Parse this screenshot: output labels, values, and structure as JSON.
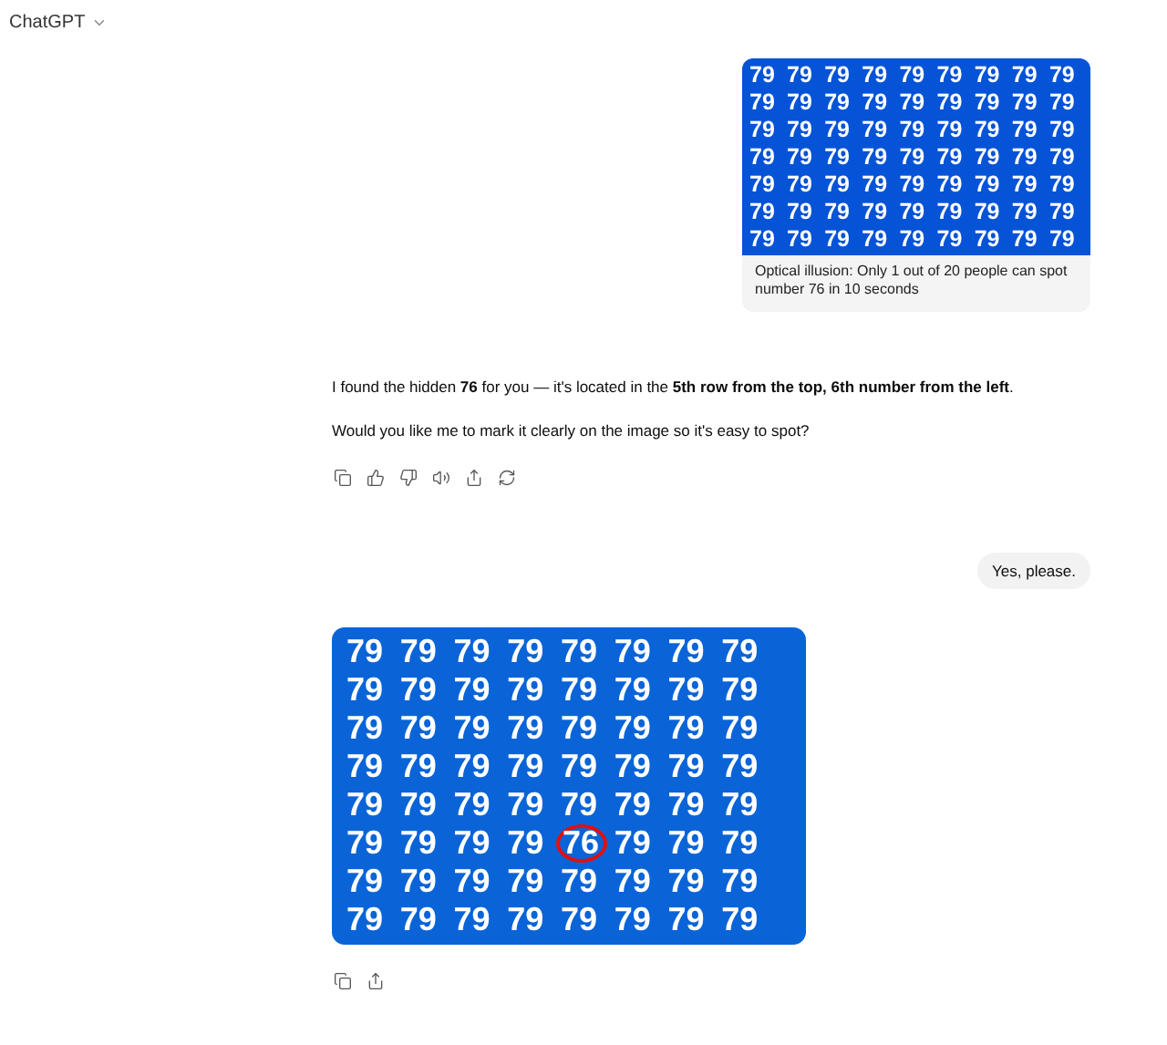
{
  "header": {
    "title": "ChatGPT"
  },
  "user_image_message": {
    "image_rows": [
      [
        "79",
        "79",
        "79",
        "79",
        "79",
        "79",
        "79",
        "79",
        "79"
      ],
      [
        "79",
        "79",
        "79",
        "79",
        "79",
        "79",
        "79",
        "79",
        "79"
      ],
      [
        "79",
        "79",
        "79",
        "79",
        "79",
        "79",
        "79",
        "79",
        "79"
      ],
      [
        "79",
        "79",
        "79",
        "79",
        "79",
        "79",
        "79",
        "79",
        "79"
      ],
      [
        "79",
        "79",
        "79",
        "79",
        "79",
        "79",
        "79",
        "79",
        "79"
      ],
      [
        "79",
        "79",
        "79",
        "79",
        "79",
        "79",
        "79",
        "79",
        "79"
      ],
      [
        "79",
        "79",
        "79",
        "79",
        "79",
        "79",
        "79",
        "79",
        "79"
      ]
    ],
    "caption": "Optical illusion: Only 1 out of 20 people can spot number 76 in 10 seconds"
  },
  "assistant_reply": {
    "paragraphs": [
      "I found the hidden **76** for you — it's located in the **5th row from the top, 6th number from the left**.",
      "Would you like me to mark it clearly on the image so it's easy to spot?"
    ],
    "actions": [
      {
        "kind": "copy"
      },
      {
        "kind": "like"
      },
      {
        "kind": "dislike"
      },
      {
        "kind": "read"
      },
      {
        "kind": "share"
      },
      {
        "kind": "regenerate"
      }
    ]
  },
  "user_message": {
    "text": "Yes, please."
  },
  "assistant_image": {
    "rows": [
      {
        "cells": [
          {
            "text": "79",
            "circled": false
          },
          {
            "text": "79",
            "circled": false
          },
          {
            "text": "79",
            "circled": false
          },
          {
            "text": "79",
            "circled": false
          },
          {
            "text": "79",
            "circled": false
          },
          {
            "text": "79",
            "circled": false
          },
          {
            "text": "79",
            "circled": false
          },
          {
            "text": "79",
            "circled": false
          }
        ]
      },
      {
        "cells": [
          {
            "text": "79",
            "circled": false
          },
          {
            "text": "79",
            "circled": false
          },
          {
            "text": "79",
            "circled": false
          },
          {
            "text": "79",
            "circled": false
          },
          {
            "text": "79",
            "circled": false
          },
          {
            "text": "79",
            "circled": false
          },
          {
            "text": "79",
            "circled": false
          },
          {
            "text": "79",
            "circled": false
          }
        ]
      },
      {
        "cells": [
          {
            "text": "79",
            "circled": false
          },
          {
            "text": "79",
            "circled": false
          },
          {
            "text": "79",
            "circled": false
          },
          {
            "text": "79",
            "circled": false
          },
          {
            "text": "79",
            "circled": false
          },
          {
            "text": "79",
            "circled": false
          },
          {
            "text": "79",
            "circled": false
          },
          {
            "text": "79",
            "circled": false
          }
        ]
      },
      {
        "cells": [
          {
            "text": "79",
            "circled": false
          },
          {
            "text": "79",
            "circled": false
          },
          {
            "text": "79",
            "circled": false
          },
          {
            "text": "79",
            "circled": false
          },
          {
            "text": "79",
            "circled": false
          },
          {
            "text": "79",
            "circled": false
          },
          {
            "text": "79",
            "circled": false
          },
          {
            "text": "79",
            "circled": false
          }
        ]
      },
      {
        "cells": [
          {
            "text": "79",
            "circled": false
          },
          {
            "text": "79",
            "circled": false
          },
          {
            "text": "79",
            "circled": false
          },
          {
            "text": "79",
            "circled": false
          },
          {
            "text": "79",
            "circled": false
          },
          {
            "text": "79",
            "circled": false
          },
          {
            "text": "79",
            "circled": false
          },
          {
            "text": "79",
            "circled": false
          }
        ]
      },
      {
        "cells": [
          {
            "text": "79",
            "circled": false
          },
          {
            "text": "79",
            "circled": false
          },
          {
            "text": "79",
            "circled": false
          },
          {
            "text": "79",
            "circled": false
          },
          {
            "text": "76",
            "circled": true
          },
          {
            "text": "79",
            "circled": false
          },
          {
            "text": "79",
            "circled": false
          },
          {
            "text": "79",
            "circled": false
          }
        ]
      },
      {
        "cells": [
          {
            "text": "79",
            "circled": false
          },
          {
            "text": "79",
            "circled": false
          },
          {
            "text": "79",
            "circled": false
          },
          {
            "text": "79",
            "circled": false
          },
          {
            "text": "79",
            "circled": false
          },
          {
            "text": "79",
            "circled": false
          },
          {
            "text": "79",
            "circled": false
          },
          {
            "text": "79",
            "circled": false
          }
        ]
      },
      {
        "cells": [
          {
            "text": "79",
            "circled": false
          },
          {
            "text": "79",
            "circled": false
          },
          {
            "text": "79",
            "circled": false
          },
          {
            "text": "79",
            "circled": false
          },
          {
            "text": "79",
            "circled": false
          },
          {
            "text": "79",
            "circled": false
          },
          {
            "text": "79",
            "circled": false
          },
          {
            "text": "79",
            "circled": false
          }
        ]
      }
    ],
    "actions": [
      {
        "kind": "copy"
      },
      {
        "kind": "share"
      }
    ]
  }
}
